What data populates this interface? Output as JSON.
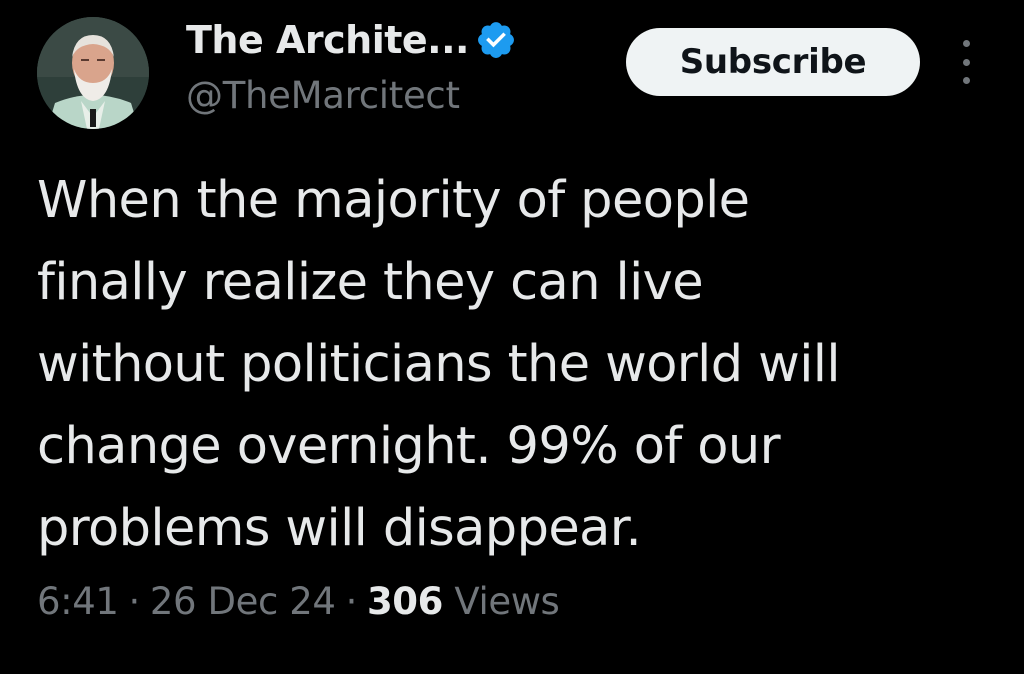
{
  "author": {
    "display_name": "The Archite...",
    "handle": "@TheMarcitect",
    "verified": true,
    "verified_icon": "verified-badge-icon",
    "verified_color": "#1d9bf0"
  },
  "actions": {
    "subscribe_label": "Subscribe",
    "more_icon": "more-vertical-icon"
  },
  "tweet": {
    "lines": [
      "When the majority of people",
      "finally realize they can live",
      "without politicians the world will",
      "change overnight. 99% of our",
      "problems will disappear."
    ]
  },
  "meta": {
    "time": "6:41",
    "separator": "·",
    "date": "26 Dec 24",
    "views_count": "306",
    "views_label": "Views"
  },
  "colors": {
    "background": "#000000",
    "primary_text": "#e7e9ea",
    "secondary_text": "#71767b",
    "button_bg": "#eff3f4"
  }
}
